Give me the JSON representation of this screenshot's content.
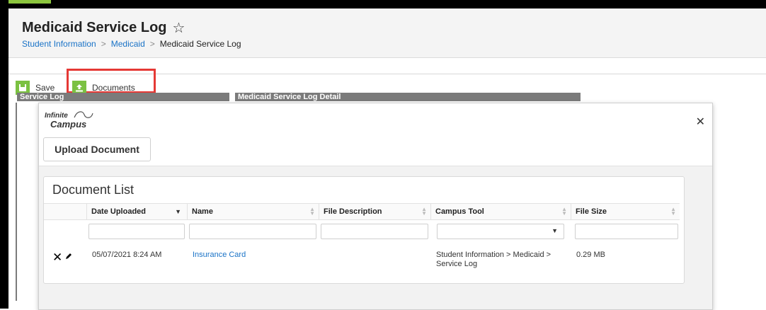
{
  "header": {
    "title": "Medicaid Service Log",
    "star_icon": "star-outline-icon",
    "breadcrumb": [
      "Student Information",
      "Medicaid",
      "Medicaid Service Log"
    ]
  },
  "toolbar": {
    "save_label": "Save",
    "documents_label": "Documents"
  },
  "panels": {
    "left_title": "Service Log",
    "right_title": "Medicaid Service Log Detail"
  },
  "modal": {
    "logo_line1": "Infinite",
    "logo_line2": "Campus",
    "close_icon": "close-icon",
    "upload_label": "Upload Document",
    "doclist_title": "Document List",
    "columns": [
      "Date Uploaded",
      "Name",
      "File Description",
      "Campus Tool",
      "File Size"
    ],
    "rows": [
      {
        "date": "05/07/2021 8:24 AM",
        "name": "Insurance Card",
        "description": "",
        "campus_tool": "Student Information > Medicaid > Service Log",
        "size": "0.29 MB"
      }
    ]
  },
  "colors": {
    "accent_green": "#7bc142",
    "highlight_red": "#e53935",
    "link_blue": "#1a73c7"
  }
}
